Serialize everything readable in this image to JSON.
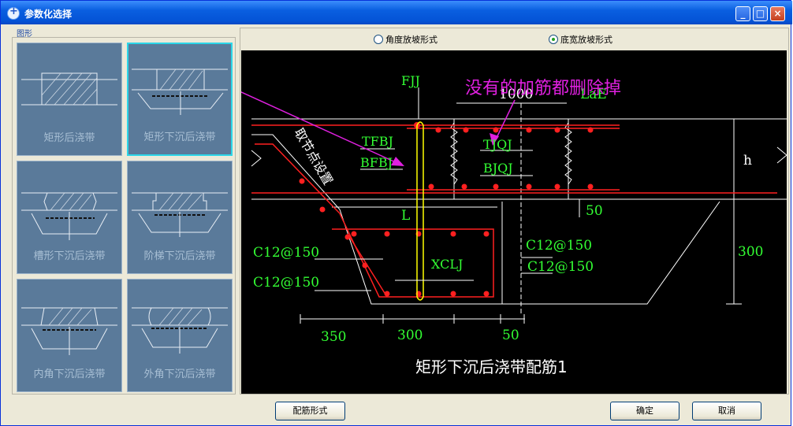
{
  "window": {
    "title": "参数化选择"
  },
  "panel": {
    "group_label": "图形"
  },
  "thumbnails": [
    {
      "label": "矩形后浇带"
    },
    {
      "label": "矩形下沉后浇带"
    },
    {
      "label": "槽形下沉后浇带"
    },
    {
      "label": "阶梯下沉后浇带"
    },
    {
      "label": "内角下沉后浇带"
    },
    {
      "label": "外角下沉后浇带"
    }
  ],
  "options": {
    "angle_label": "角度放坡形式",
    "width_label": "底宽放坡形式",
    "selected": "width"
  },
  "drawing": {
    "annotation": "没有的加筋都删除掉",
    "caption": "矩形下沉后浇带配筋1",
    "rotated_label": "取节点设置",
    "labels": {
      "fjj": "FJJ",
      "dim_1000": "1000",
      "lae": "LaE",
      "tfbj": "TFBJ",
      "bfbj": "BFBJ",
      "tjqj": "TJQJ",
      "bjqj": "BJQJ",
      "h": "h",
      "l": "L",
      "d50_top": "50",
      "c12_1": "C12@150",
      "c12_2": "C12@150",
      "c12_3": "C12@150",
      "c12_4": "C12@150",
      "xclj": "XCLJ",
      "d300_right": "300",
      "d350": "350",
      "d300_bottom": "300",
      "d50_bottom": "50"
    }
  },
  "buttons": {
    "rebar": "配筋形式",
    "ok": "确定",
    "cancel": "取消"
  }
}
